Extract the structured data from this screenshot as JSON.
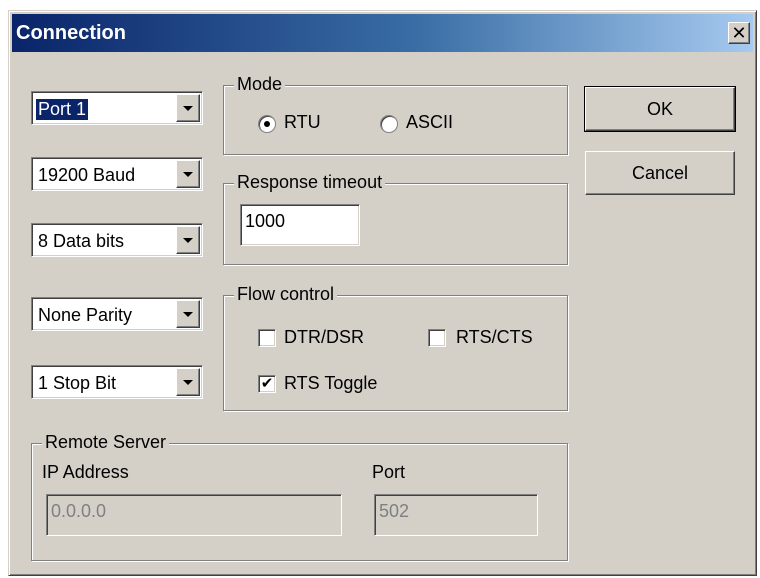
{
  "window": {
    "title": "Connection",
    "close_glyph": "✕"
  },
  "serial": {
    "port": "Port 1",
    "baud": "19200 Baud",
    "data_bits": "8 Data bits",
    "parity": "None Parity",
    "stop_bits": "1 Stop Bit"
  },
  "mode": {
    "legend": "Mode",
    "options": [
      {
        "label": "RTU",
        "selected": true
      },
      {
        "label": "ASCII",
        "selected": false
      }
    ]
  },
  "response_timeout": {
    "legend": "Response timeout",
    "value": "1000"
  },
  "flow_control": {
    "legend": "Flow control",
    "dtr_dsr": {
      "label": "DTR/DSR",
      "checked": false
    },
    "rts_cts": {
      "label": "RTS/CTS",
      "checked": false
    },
    "rts_toggle": {
      "label": "RTS Toggle",
      "checked": true,
      "mark": "✔"
    }
  },
  "remote_server": {
    "legend": "Remote Server",
    "ip_label": "IP Address",
    "ip_value": "0.0.0.0",
    "port_label": "Port",
    "port_value": "502"
  },
  "buttons": {
    "ok": "OK",
    "cancel": "Cancel"
  }
}
